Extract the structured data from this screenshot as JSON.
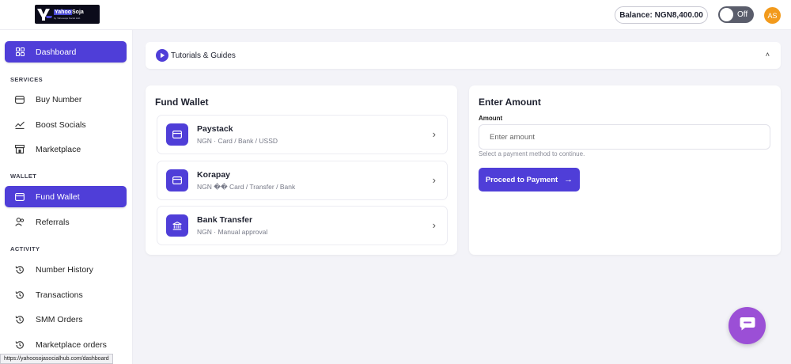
{
  "header": {
    "logo": {
      "brand_a": "Yahoo",
      "brand_b": "Soja",
      "tagline": "by Yahoosoja Social Hub"
    },
    "balance_label": "Balance: NGN8,400.00",
    "toggle_label": "Off",
    "avatar_initials": "AS"
  },
  "sidebar": {
    "dashboard": "Dashboard",
    "sections": {
      "services": "SERVICES",
      "wallet": "WALLET",
      "activity": "ACTIVITY"
    },
    "items": {
      "buy_number": "Buy Number",
      "boost_socials": "Boost Socials",
      "marketplace": "Marketplace",
      "fund_wallet": "Fund Wallet",
      "referrals": "Referrals",
      "number_history": "Number History",
      "transactions": "Transactions",
      "smm_orders": "SMM Orders",
      "marketplace_orders": "Marketplace orders"
    }
  },
  "tutorials": {
    "title": "Tutorials & Guides",
    "chevron": "˄"
  },
  "fund_wallet": {
    "title": "Fund Wallet",
    "methods": [
      {
        "name": "Paystack",
        "desc": "NGN · Card / Bank / USSD",
        "icon": "card-icon"
      },
      {
        "name": "Korapay",
        "desc": "NGN �� Card / Transfer / Bank",
        "icon": "card-icon"
      },
      {
        "name": "Bank Transfer",
        "desc": "NGN · Manual approval",
        "icon": "bank-icon"
      }
    ]
  },
  "enter_amount": {
    "title": "Enter Amount",
    "field_label": "Amount",
    "placeholder": "Enter amount",
    "hint": "Select a payment method to continue.",
    "button_label": "Proceed to Payment"
  },
  "status_bar_url": "https://yahoosojasocialhub.com/dashboard",
  "colors": {
    "accent": "#4f3ed8",
    "chat": "#9b4fd6",
    "avatar": "#f29a1c",
    "toggle": "#5a5d6b"
  }
}
